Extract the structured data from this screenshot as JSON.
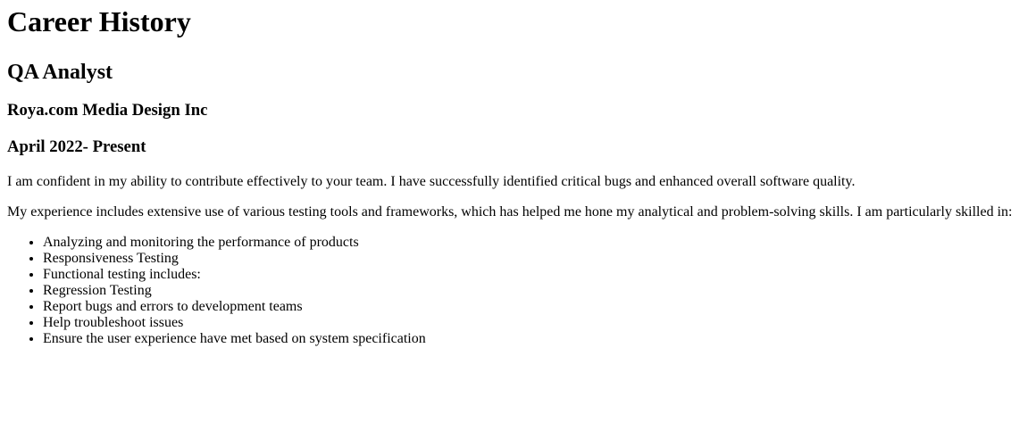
{
  "heading": "Career History",
  "job": {
    "title": "QA Analyst",
    "company": "Roya.com Media Design Inc",
    "dates": "April 2022- Present"
  },
  "intro": "I am confident in my ability to contribute effectively to your team. I have successfully identified critical bugs and enhanced overall software quality.",
  "experience": "My experience includes extensive use of various testing tools and frameworks, which has helped me hone my analytical and problem-solving skills. I am particularly skilled in:",
  "skills": [
    "Analyzing and monitoring the performance of products",
    "Responsiveness Testing",
    "Functional testing includes:",
    "Regression Testing",
    "Report bugs and errors to development teams",
    "Help troubleshoot issues",
    "Ensure the user experience have met based on system specification"
  ]
}
